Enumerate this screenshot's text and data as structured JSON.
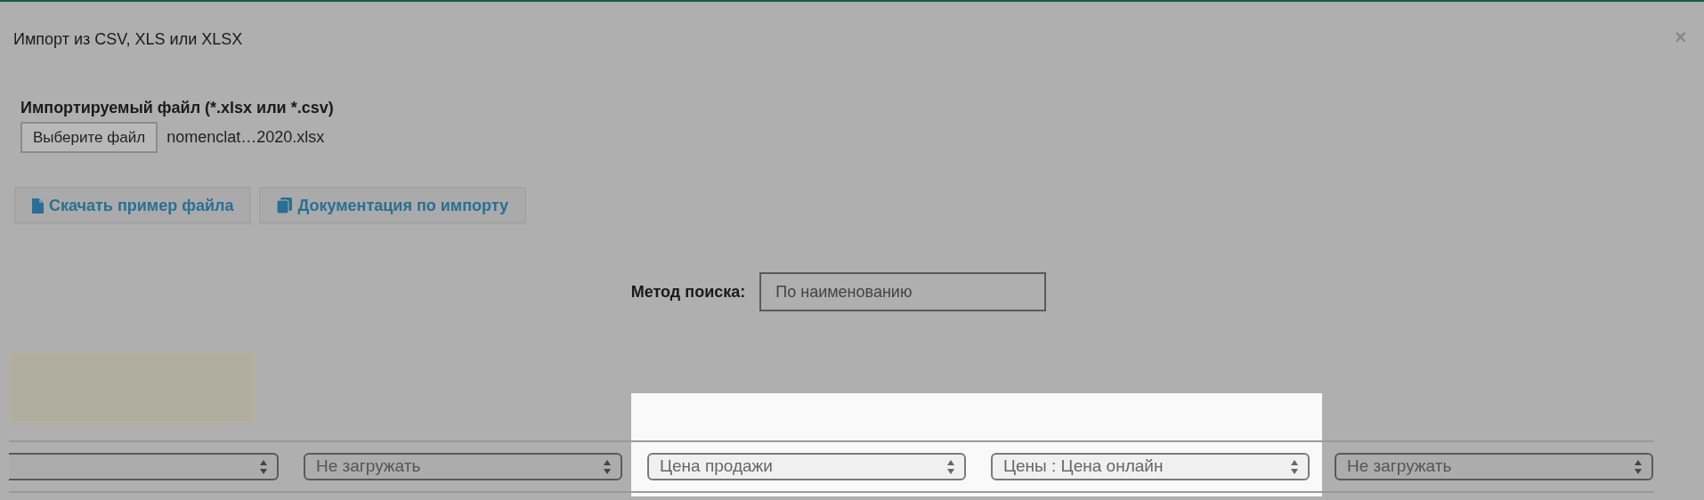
{
  "dialog": {
    "title": "Импорт из CSV, XLS или XLSX",
    "close": "×"
  },
  "file_field": {
    "label": "Импортируемый файл (*.xlsx или *.csv)",
    "button": "Выберите файл",
    "file_name": "nomenclat…2020.xlsx"
  },
  "links": [
    {
      "kind": "file",
      "label": "Скачать пример файла"
    },
    {
      "kind": "book",
      "label": "Документация по импорту"
    }
  ],
  "search_method": {
    "label": "Метод поиска:",
    "value": "По наименованию"
  },
  "columns": [
    {
      "highlighted": false
    },
    {
      "value": "Не загружать",
      "highlighted": false
    },
    {
      "value": "Цена продажи",
      "highlighted": true
    },
    {
      "value": "Цены : Цена онлайн",
      "highlighted": true
    },
    {
      "value": "Не загружать",
      "highlighted": false
    }
  ]
}
